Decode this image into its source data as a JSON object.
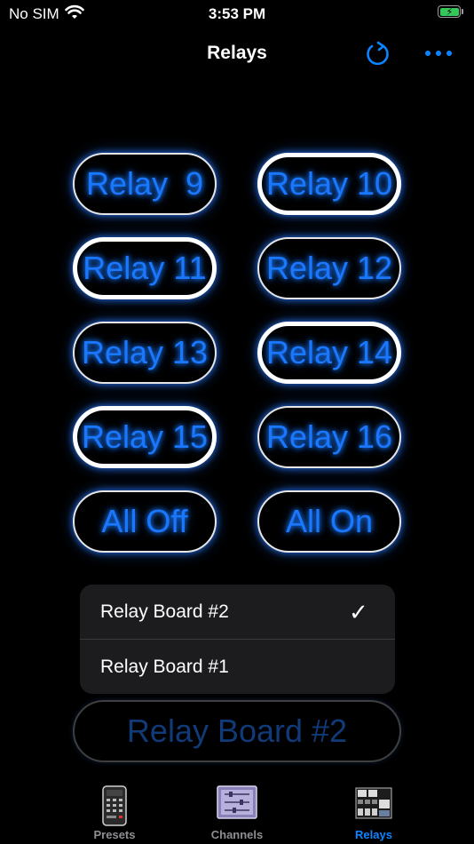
{
  "status_bar": {
    "carrier": "No SIM",
    "time": "3:53 PM"
  },
  "nav": {
    "title": "Relays",
    "accent": "#0a84ff"
  },
  "relays": [
    {
      "label": "Relay  9",
      "on": false
    },
    {
      "label": "Relay 10",
      "on": true
    },
    {
      "label": "Relay 11",
      "on": true
    },
    {
      "label": "Relay 12",
      "on": false
    },
    {
      "label": "Relay 13",
      "on": false
    },
    {
      "label": "Relay 14",
      "on": true
    },
    {
      "label": "Relay 15",
      "on": true
    },
    {
      "label": "Relay 16",
      "on": false
    },
    {
      "label": "All Off",
      "on": false
    },
    {
      "label": "All On",
      "on": false
    }
  ],
  "board_menu": {
    "items": [
      {
        "label": "Relay Board #2",
        "selected": true
      },
      {
        "label": "Relay Board #1",
        "selected": false
      }
    ],
    "check_glyph": "✓"
  },
  "board_button": {
    "label": "Relay Board #2"
  },
  "tabs": [
    {
      "label": "Presets",
      "icon": "remote-control-icon",
      "active": false
    },
    {
      "label": "Channels",
      "icon": "sliders-icon",
      "active": false
    },
    {
      "label": "Relays",
      "icon": "relay-board-icon",
      "active": true
    }
  ]
}
